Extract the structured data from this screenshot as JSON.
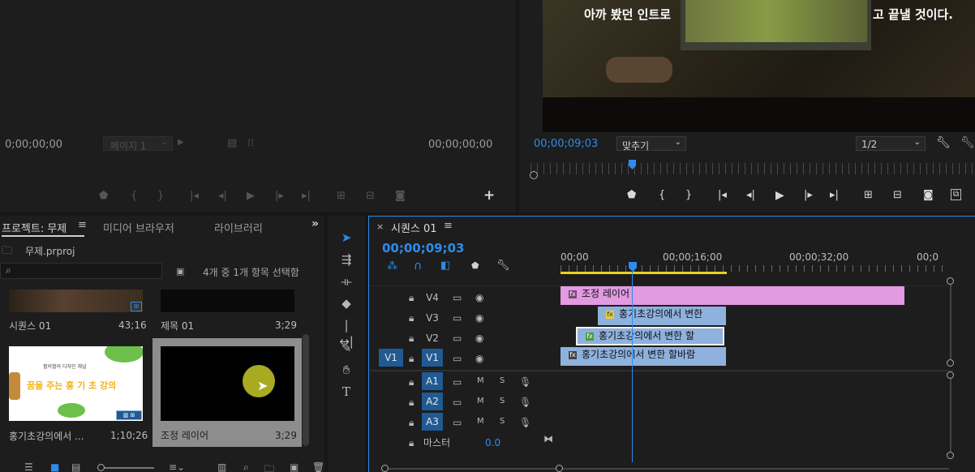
{
  "source_monitor": {
    "timecode_left": "0;00;00;00",
    "page_select": "페이지 1",
    "timecode_right": "00;00;00;00"
  },
  "program_monitor": {
    "subtitle_left": "아까 봤던 인트로",
    "subtitle_right": "고 끝낼 것이다.",
    "timecode": "00;00;09;03",
    "fit_select": "맞추기",
    "resolution_select": "1/2"
  },
  "project_panel": {
    "tabs": [
      "프로젝트: 무제",
      "미디어 브라우저",
      "라이브러리"
    ],
    "project_file": "무제.prproj",
    "items_count": "4개 중 1개 항목 선택함",
    "items": [
      {
        "name": "시퀀스 01",
        "duration": "43;16"
      },
      {
        "name": "제목 01",
        "duration": "3;29"
      },
      {
        "name": "홍기초강의에서 ...",
        "duration": "1;10;26"
      },
      {
        "name": "조정 레이어",
        "duration": "3;29"
      }
    ],
    "thumb_text_small": "혈의혈의 디자인 채널",
    "thumb_text_big": "꿈을 주는 홍 기 초 강의"
  },
  "timeline": {
    "tab_label": "시퀀스 01",
    "timecode": "00;00;09;03",
    "ruler": [
      "00;00",
      "00;00;16;00",
      "00;00;32;00",
      "00;0"
    ],
    "video_tracks": [
      "V4",
      "V3",
      "V2",
      "V1"
    ],
    "source_patch_v": "V1",
    "audio_tracks": [
      "A1",
      "A2",
      "A3"
    ],
    "mute_label": "M",
    "solo_label": "S",
    "master_label": "마스터",
    "master_value": "0.0",
    "clips": {
      "v4": "조정 레이어",
      "v3": "홍기초강의에서 변한",
      "v2": "홍기초강의에서 변한 할",
      "v1": "홍기초강의에서 변한 할바람"
    }
  },
  "colors": {
    "accent_blue": "#2d8ceb",
    "adjustment_clip": "#e29ae0",
    "video_clip": "#8eb1de",
    "work_area": "#e6d21e"
  },
  "icons": [
    "marker-icon",
    "in-point-icon",
    "out-point-icon",
    "go-to-in-icon",
    "step-back-icon",
    "play-icon",
    "step-forward-icon",
    "go-to-out-icon",
    "lift-icon",
    "extract-icon",
    "export-frame-icon",
    "add-button-icon",
    "wrench-icon",
    "selection-tool-icon",
    "track-select-icon",
    "ripple-edit-icon",
    "razor-icon",
    "slip-icon",
    "pen-icon",
    "hand-icon",
    "type-icon"
  ]
}
